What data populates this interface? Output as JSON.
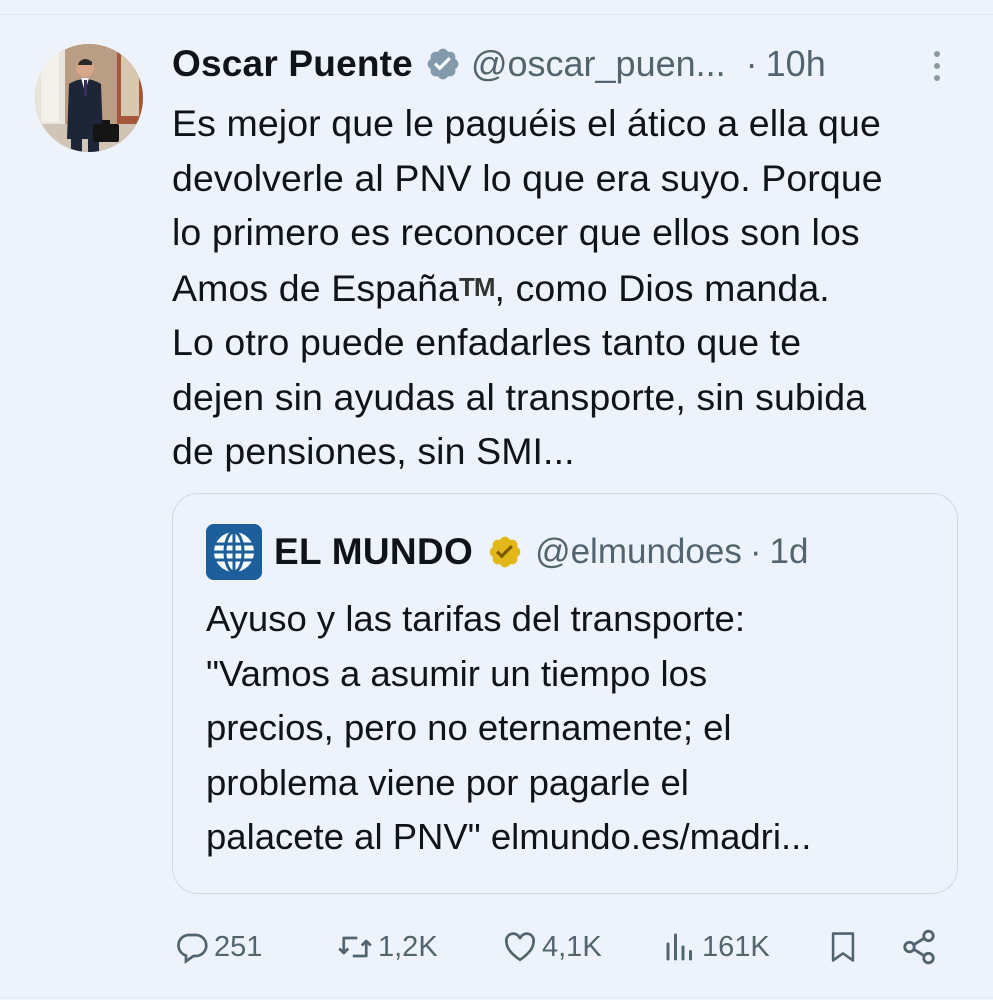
{
  "tweet": {
    "author_name": "Oscar Puente",
    "handle": "@oscar_puen...",
    "separator": "·",
    "time": "10h",
    "text_lines": [
      "Es mejor que le paguéis el ático a ella que",
      "devolverle al PNV lo que era suyo. Porque",
      "lo primero es reconocer que ellos son los",
      "Amos de España",
      "TM",
      ", como Dios manda.",
      "Lo otro puede enfadarles tanto que te",
      "dejen sin ayudas al transporte, sin subida",
      "de pensiones, sin SMI..."
    ]
  },
  "quoted": {
    "author_name": "EL MUNDO",
    "handle": "@elmundoes",
    "separator": "·",
    "time": "1d",
    "text_lines": [
      "Ayuso y las tarifas del transporte:",
      "\"Vamos a asumir un tiempo los",
      "precios, pero no eternamente; el",
      "problema viene por pagarle el",
      "palacete al PNV\" elmundo.es/madri..."
    ]
  },
  "actions": {
    "replies": "251",
    "retweets": "1,2K",
    "likes": "4,1K",
    "views": "161K"
  },
  "colors": {
    "background": "#eef3fb",
    "text": "#0f1419",
    "secondary": "#536471",
    "verified_blue": "#829aab",
    "verified_gold": "#e2b719"
  },
  "icons": [
    "verified-badge-icon",
    "more-icon",
    "reply-icon",
    "retweet-icon",
    "like-icon",
    "views-icon",
    "bookmark-icon",
    "share-icon"
  ]
}
